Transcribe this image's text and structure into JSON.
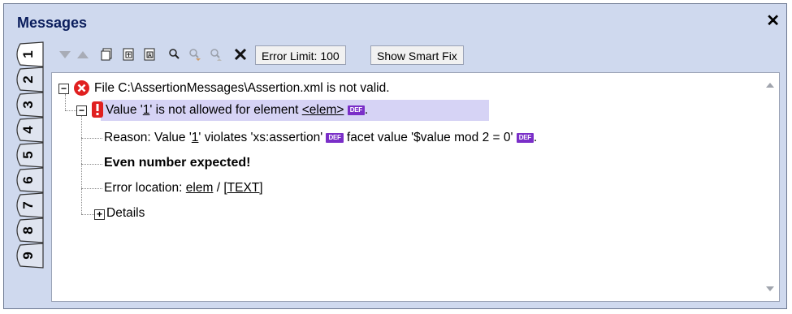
{
  "window": {
    "title": "Messages",
    "close_glyph": "✕"
  },
  "tabs": [
    "1",
    "2",
    "3",
    "4",
    "5",
    "6",
    "7",
    "8",
    "9"
  ],
  "toolbar": {
    "error_limit_label": "Error Limit: 100",
    "smart_fix_label": "Show Smart Fix",
    "icons": [
      "next-arrow-icon",
      "previous-arrow-icon",
      "copy-message-icon",
      "copy-all-icon",
      "copy-all-children-icon",
      "find-icon",
      "find-next-icon",
      "find-previous-icon",
      "clear-icon"
    ]
  },
  "messages": {
    "file_line": "File C:\\AssertionMessages\\Assertion.xml is not valid.",
    "value_prefix": "Value '",
    "value_num": "1",
    "value_mid": "' is not allowed for element ",
    "value_elem": "<elem>",
    "value_end": ".",
    "reason_prefix": "Reason: Value '",
    "reason_num": "1",
    "reason_mid": "' violates 'xs:assertion'",
    "reason_facet": " facet value '$value mod 2 = 0'",
    "reason_end": ".",
    "bold_line": "Even number expected!",
    "location_prefix": "Error location: ",
    "location_elem": "elem",
    "location_sep": " / ",
    "location_text": "[TEXT]",
    "details_label": "Details",
    "def_badge": "DEF",
    "collapse_glyph": "−",
    "expand_glyph": "+"
  },
  "colors": {
    "error_red": "#e02020",
    "def_purple": "#7a2ec8",
    "selection": "#d6d3f5",
    "title_bg": "#cfd9ee"
  }
}
